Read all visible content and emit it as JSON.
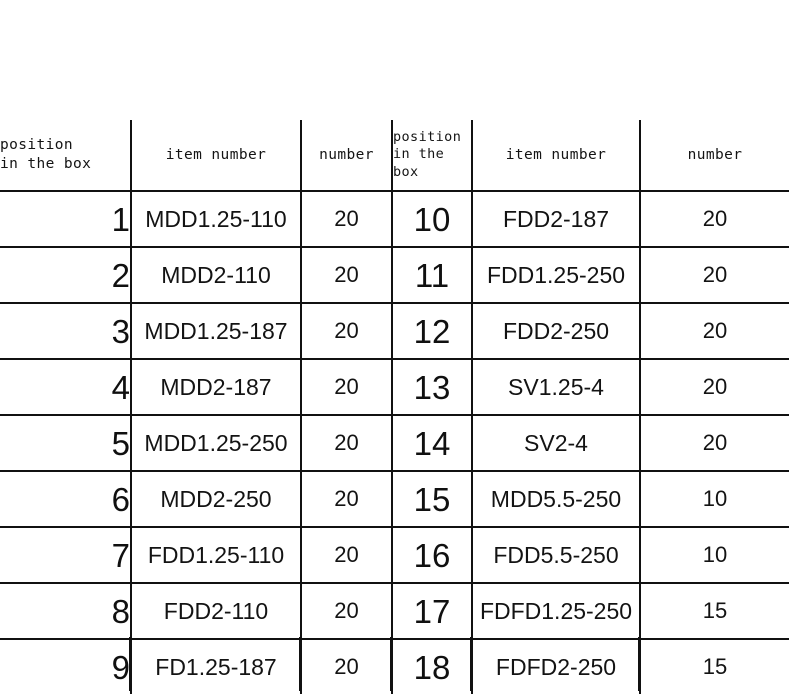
{
  "table": {
    "columns": [
      {
        "key": "position_left",
        "label": "position\nin the box"
      },
      {
        "key": "item_left",
        "label": "item number"
      },
      {
        "key": "number_left",
        "label": "number"
      },
      {
        "key": "position_right",
        "label": "position\nin the\nbox"
      },
      {
        "key": "item_right",
        "label": "item number"
      },
      {
        "key": "number_right",
        "label": "number"
      }
    ],
    "rows": [
      {
        "pos_l": "1",
        "item_l": "MDD1.25-110",
        "num_l": "20",
        "pos_r": "10",
        "item_r": "FDD2-187",
        "num_r": "20"
      },
      {
        "pos_l": "2",
        "item_l": "MDD2-110",
        "num_l": "20",
        "pos_r": "11",
        "item_r": "FDD1.25-250",
        "num_r": "20"
      },
      {
        "pos_l": "3",
        "item_l": "MDD1.25-187",
        "num_l": "20",
        "pos_r": "12",
        "item_r": "FDD2-250",
        "num_r": "20"
      },
      {
        "pos_l": "4",
        "item_l": "MDD2-187",
        "num_l": "20",
        "pos_r": "13",
        "item_r": "SV1.25-4",
        "num_r": "20"
      },
      {
        "pos_l": "5",
        "item_l": "MDD1.25-250",
        "num_l": "20",
        "pos_r": "14",
        "item_r": "SV2-4",
        "num_r": "20"
      },
      {
        "pos_l": "6",
        "item_l": "MDD2-250",
        "num_l": "20",
        "pos_r": "15",
        "item_r": "MDD5.5-250",
        "num_r": "10"
      },
      {
        "pos_l": "7",
        "item_l": "FDD1.25-110",
        "num_l": "20",
        "pos_r": "16",
        "item_r": "FDD5.5-250",
        "num_r": "10"
      },
      {
        "pos_l": "8",
        "item_l": "FDD2-110",
        "num_l": "20",
        "pos_r": "17",
        "item_r": "FDFD1.25-250",
        "num_r": "15"
      },
      {
        "pos_l": "9",
        "item_l": "FD1.25-187",
        "num_l": "20",
        "pos_r": "18",
        "item_r": "FDFD2-250",
        "num_r": "15"
      }
    ]
  },
  "style": {
    "rule_color": "#111111",
    "text_color": "#131313",
    "background": "#ffffff"
  }
}
